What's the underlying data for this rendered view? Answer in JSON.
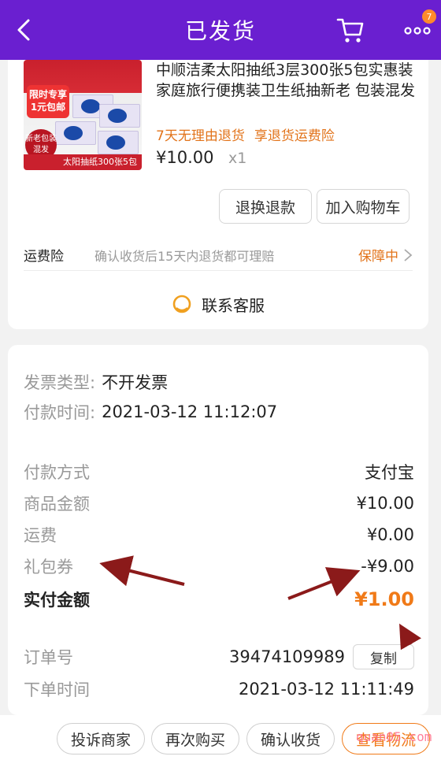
{
  "header": {
    "title": "已发货",
    "cart_badge": "7",
    "color": "#6a1fd0"
  },
  "product": {
    "title": "中顺洁柔太阳抽纸3层300张5包实惠装家庭旅行便携装卫生纸抽新老 包装混发",
    "tag1": "7天无理由退货",
    "tag2": "享退货运费险",
    "price": "¥10.00",
    "qty": "x1",
    "thumb_promo": "限时专享 1元包邮",
    "thumb_circle": "新老包装 混发",
    "thumb_bottom": "太阳抽纸300张5包"
  },
  "actions": {
    "refund": "退换退款",
    "add_cart": "加入购物车"
  },
  "insurance": {
    "label": "运费险",
    "desc": "确认收货后15天内退货都可理赔",
    "status": "保障中"
  },
  "contact": {
    "label": "联系客服"
  },
  "invoice": {
    "type_label": "发票类型:",
    "type_value": "不开发票",
    "pay_time_label": "付款时间:",
    "pay_time_value": "2021-03-12 11:12:07"
  },
  "payment": {
    "method_label": "付款方式",
    "method_value": "支付宝",
    "goods_label": "商品金额",
    "goods_value": "¥10.00",
    "shipping_label": "运费",
    "shipping_value": "¥0.00",
    "coupon_label": "礼包券",
    "coupon_value": "-¥9.00",
    "paid_label": "实付金额",
    "paid_value": "¥1.00"
  },
  "order": {
    "no_label": "订单号",
    "no_value": "39474109989",
    "copy": "复制",
    "time_label": "下单时间",
    "time_value": "2021-03-12 11:11:49"
  },
  "bottom": {
    "complain": "投诉商家",
    "rebuy": "再次购买",
    "confirm": "确认收货",
    "logistics": "查看物流"
  },
  "watermark": "quan05.com",
  "colors": {
    "accent_orange": "#f07a18",
    "annotation_arrow": "#8b1a1a"
  }
}
